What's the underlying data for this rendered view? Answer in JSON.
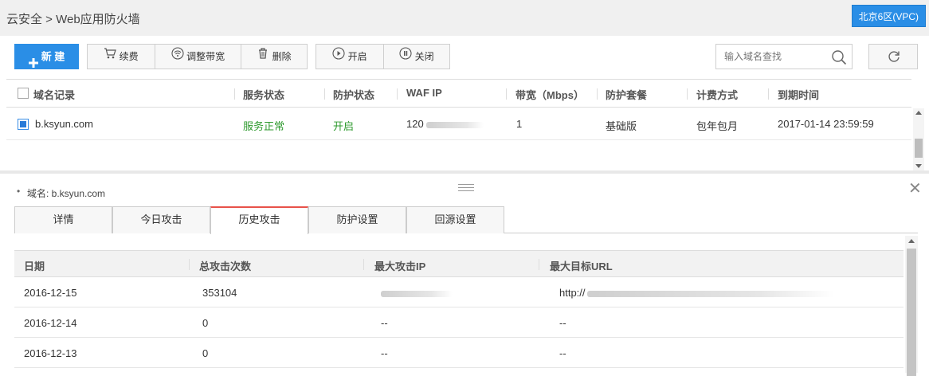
{
  "header": {
    "breadcrumb": "云安全 > Web应用防火墙",
    "region_button": "北京6区(VPC)"
  },
  "toolbar": {
    "new_label": "新 建",
    "renew_label": "续费",
    "adjust_bandwidth_label": "调整带宽",
    "delete_label": "删除",
    "enable_label": "开启",
    "disable_label": "关闭",
    "search_placeholder": "输入域名查找"
  },
  "domain_table": {
    "columns": [
      "域名记录",
      "服务状态",
      "防护状态",
      "WAF IP",
      "带宽（Mbps）",
      "防护套餐",
      "计费方式",
      "到期时间"
    ],
    "rows": [
      {
        "domain": "b.ksyun.com",
        "service_status": "服务正常",
        "protection_status": "开启",
        "waf_ip": "120",
        "bandwidth": "1",
        "package": "基础版",
        "billing": "包年包月",
        "expire": "2017-01-14 23:59:59"
      }
    ]
  },
  "detail": {
    "domain_label": "域名: b.ksyun.com",
    "tabs": [
      "详情",
      "今日攻击",
      "历史攻击",
      "防护设置",
      "回源设置"
    ],
    "active_tab": "历史攻击",
    "columns": [
      "日期",
      "总攻击次数",
      "最大攻击IP",
      "最大目标URL"
    ],
    "rows": [
      {
        "date": "2016-12-15",
        "count": "353104",
        "ip": "",
        "url": "http://"
      },
      {
        "date": "2016-12-14",
        "count": "0",
        "ip": "--",
        "url": "--"
      },
      {
        "date": "2016-12-13",
        "count": "0",
        "ip": "--",
        "url": "--"
      }
    ]
  },
  "colors": {
    "primary": "#2a8ee6",
    "status_green": "#2e9a2e",
    "active_tab_accent": "#e8524a"
  }
}
